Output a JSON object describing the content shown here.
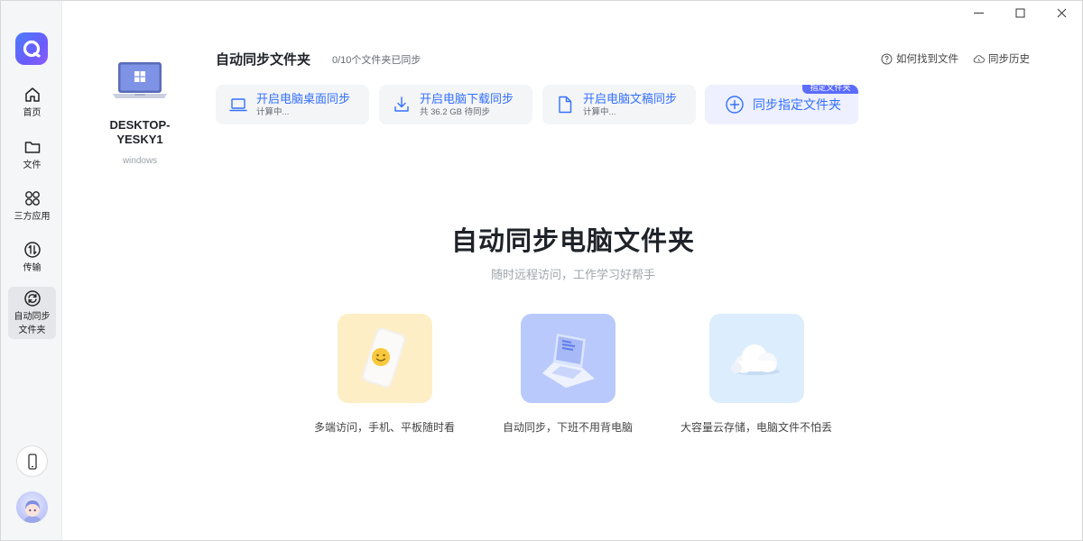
{
  "sidebar": {
    "items": [
      {
        "label": "首页",
        "icon": "home-icon"
      },
      {
        "label": "文件",
        "icon": "folder-icon"
      },
      {
        "label": "三方应用",
        "icon": "apps-icon"
      },
      {
        "label": "传输",
        "icon": "transfer-icon"
      },
      {
        "label": "自动同步",
        "label2": "文件夹",
        "icon": "sync-icon",
        "active": true
      }
    ],
    "bottom": [
      {
        "icon": "phone-icon"
      },
      {
        "icon": "avatar"
      }
    ]
  },
  "device": {
    "name_line1": "DESKTOP-",
    "name_line2": "YESKY1",
    "os": "windows"
  },
  "header": {
    "title": "自动同步文件夹",
    "status": "0/10个文件夹已同步",
    "links": [
      {
        "label": "如何找到文件",
        "icon": "help-circle-icon"
      },
      {
        "label": "同步历史",
        "icon": "cloud-history-icon"
      }
    ]
  },
  "cards": [
    {
      "title": "开启电脑桌面同步",
      "sub": "计算中...",
      "icon": "laptop-icon"
    },
    {
      "title": "开启电脑下载同步",
      "sub": "共 36.2 GB 待同步",
      "icon": "download-icon"
    },
    {
      "title": "开启电脑文稿同步",
      "sub": "计算中...",
      "icon": "document-icon"
    },
    {
      "title": "同步指定文件夹",
      "icon": "plus-circle-icon",
      "badge": "指定文件夹"
    }
  ],
  "hero": {
    "title": "自动同步电脑文件夹",
    "subtitle": "随时远程访问，工作学习好帮手"
  },
  "features": [
    {
      "caption": "多端访问，手机、平板随时看",
      "color": "#fdeec6"
    },
    {
      "caption": "自动同步，下班不用背电脑",
      "color": "#b9c9fb"
    },
    {
      "caption": "大容量云存储，电脑文件不怕丢",
      "color": "#dcedfd"
    }
  ],
  "colors": {
    "accent": "#3370ff",
    "rail_bg": "#f5f6f8",
    "card_bg": "#f4f5f7"
  }
}
